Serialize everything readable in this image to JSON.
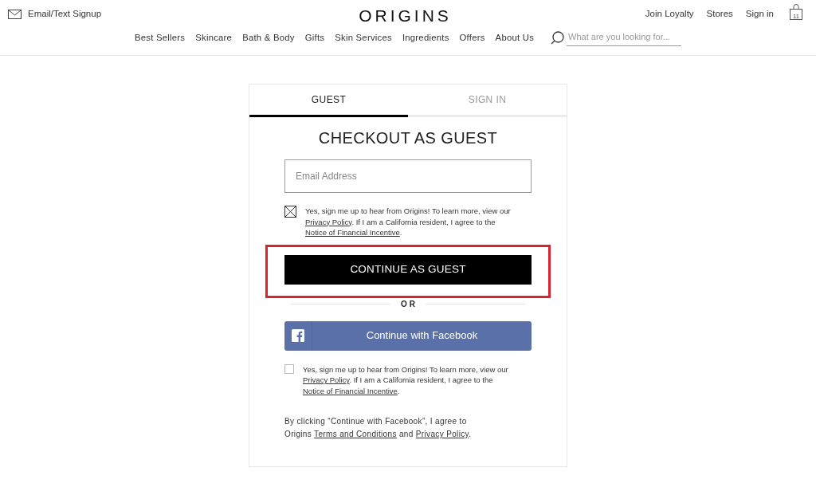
{
  "header": {
    "signup_link": "Email/Text Signup",
    "logo": "ORIGINS",
    "account_links": [
      "Join Loyalty",
      "Stores",
      "Sign in"
    ],
    "cart_count": "11"
  },
  "nav": {
    "items": [
      "Best Sellers",
      "Skincare",
      "Bath & Body",
      "Gifts",
      "Skin Services",
      "Ingredients",
      "Offers",
      "About Us"
    ],
    "search": {
      "placeholder": "What are you looking for..."
    }
  },
  "checkout": {
    "tabs": [
      {
        "label": "GUEST",
        "selected": true
      },
      {
        "label": "SIGN IN",
        "selected": false
      }
    ],
    "title": "CHECKOUT AS GUEST",
    "email_field": {
      "placeholder": "Email Address"
    },
    "guest_consent": {
      "checked": true,
      "segments": [
        {
          "kind": "text",
          "text": "Yes, sign me up to hear from Origins! To learn more, view our "
        },
        {
          "kind": "link",
          "text": "Privacy Policy"
        },
        {
          "kind": "text",
          "text": ". If I am a California resident, I agree to the "
        },
        {
          "kind": "link",
          "text": "Notice of Financial Incentive"
        },
        {
          "kind": "text",
          "text": "."
        }
      ]
    },
    "continue_button": {
      "label": "CONTINUE AS GUEST",
      "highlighted": true
    },
    "divider_text": "OR",
    "facebook_button": {
      "label": "Continue with Facebook"
    },
    "facebook_consent": {
      "checked": false,
      "segments": [
        {
          "kind": "text",
          "text": "Yes, sign me up to hear from Origins! To learn more, view our "
        },
        {
          "kind": "link",
          "text": "Privacy Policy"
        },
        {
          "kind": "text",
          "text": ". If I am a California resident, I agree to the "
        },
        {
          "kind": "link",
          "text": "Notice of Financial Incentive"
        },
        {
          "kind": "text",
          "text": "."
        }
      ]
    },
    "legal_note": [
      {
        "kind": "text",
        "text": "By clicking “Continue with Facebook”, I agree to Origins "
      },
      {
        "kind": "link",
        "text": "Terms and Conditions"
      },
      {
        "kind": "text",
        "text": " and "
      },
      {
        "kind": "link",
        "text": "Privacy Policy"
      },
      {
        "kind": "text",
        "text": "."
      }
    ]
  }
}
